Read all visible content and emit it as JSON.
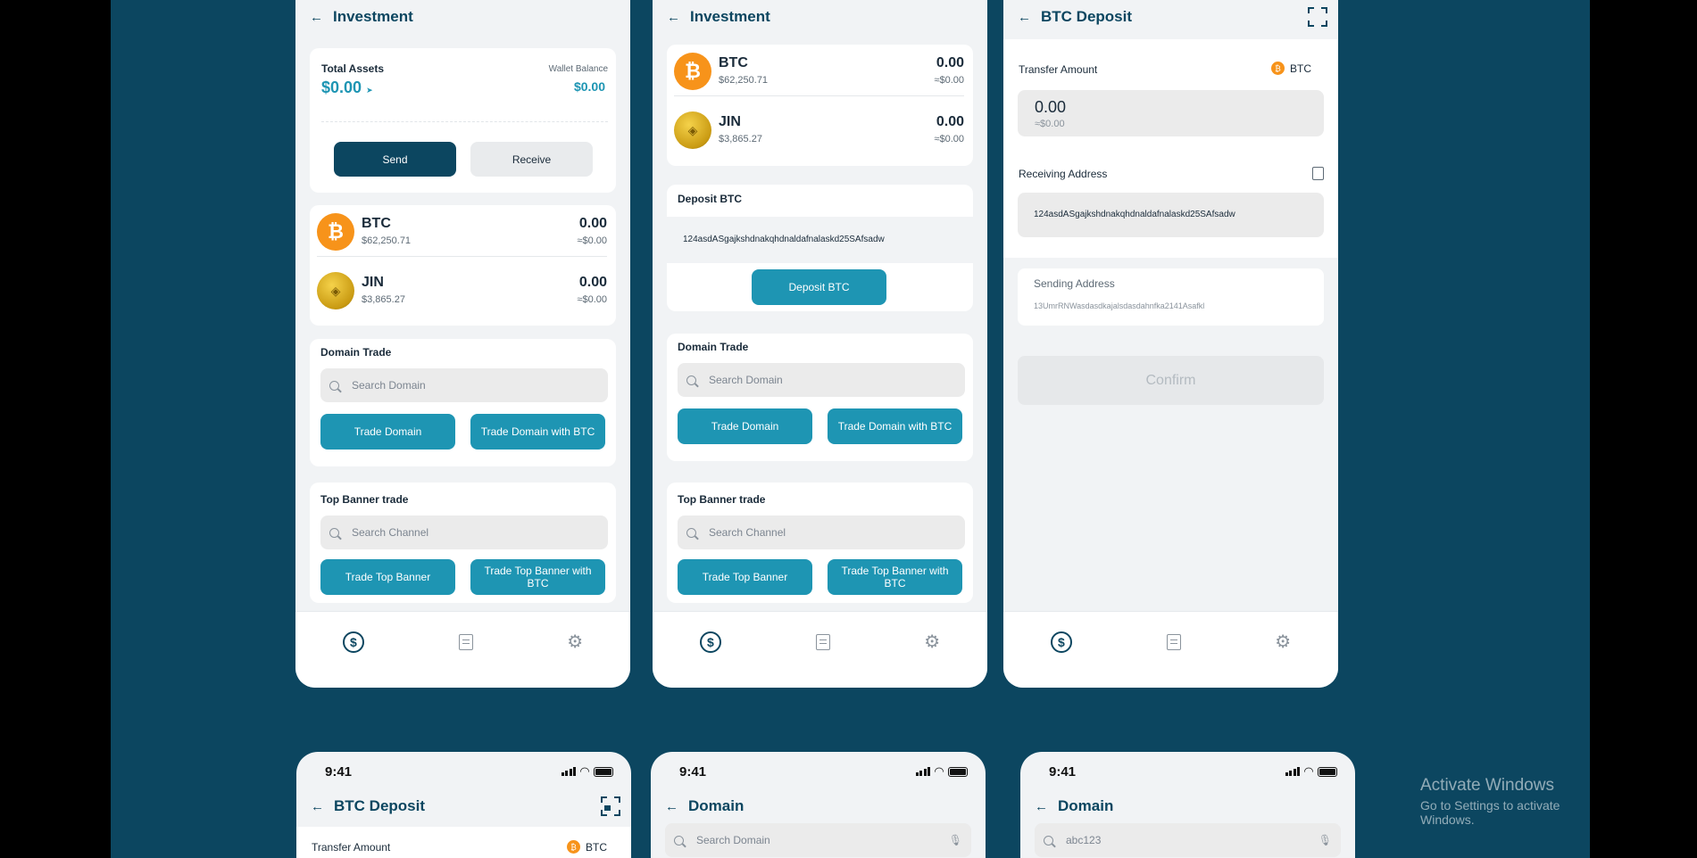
{
  "colors": {
    "background": "#0c4660",
    "primary": "#0c4660",
    "accent": "#1e95b3",
    "btc": "#f7931a"
  },
  "investment": {
    "title": "Investment",
    "total_assets_label": "Total Assets",
    "total_assets_value": "$0.00",
    "wallet_balance_label": "Wallet Balance",
    "wallet_balance_value": "$0.00",
    "send": "Send",
    "receive": "Receive"
  },
  "coins": [
    {
      "symbol": "BTC",
      "price": "$62,250.71",
      "amount": "0.00",
      "fiat": "≈$0.00",
      "icon": "bitcoin-icon"
    },
    {
      "symbol": "JIN",
      "price": "$3,865.27",
      "amount": "0.00",
      "fiat": "≈$0.00",
      "icon": "jin-coin-icon"
    }
  ],
  "domain_trade": {
    "title": "Domain Trade",
    "placeholder": "Search Domain",
    "trade": "Trade Domain",
    "trade_btc": "Trade Domain with BTC"
  },
  "banner_trade": {
    "title": "Top Banner trade",
    "placeholder": "Search Channel",
    "trade": "Trade Top Banner",
    "trade_btc": "Trade Top Banner with BTC"
  },
  "deposit_card": {
    "title": "Deposit BTC",
    "address": "124asdASgajkshdnakqhdnaldafnalaskd25SAfsadw",
    "button": "Deposit BTC"
  },
  "btc_deposit": {
    "title": "BTC Deposit",
    "transfer_label": "Transfer Amount",
    "currency": "BTC",
    "amount": "0.00",
    "amount_fiat": "≈$0.00",
    "receiving_label": "Receiving Address",
    "receiving_address": "124asdASgajkshdnakqhdnaldafnalaskd25SAfsadw",
    "sending_label": "Sending Address",
    "sending_address": "13UmrRNWasdasdkajalsdasdahnfka2141Asafkl",
    "confirm": "Confirm"
  },
  "bottom": {
    "time": "9:41",
    "deposit_title": "BTC Deposit",
    "transfer_label": "Transfer Amount",
    "currency": "BTC",
    "domain_title": "Domain",
    "search_placeholder": "Search Domain",
    "search_value": "abc123"
  },
  "watermark": {
    "line1": "Activate Windows",
    "line2": "Go to Settings to activate Windows."
  }
}
